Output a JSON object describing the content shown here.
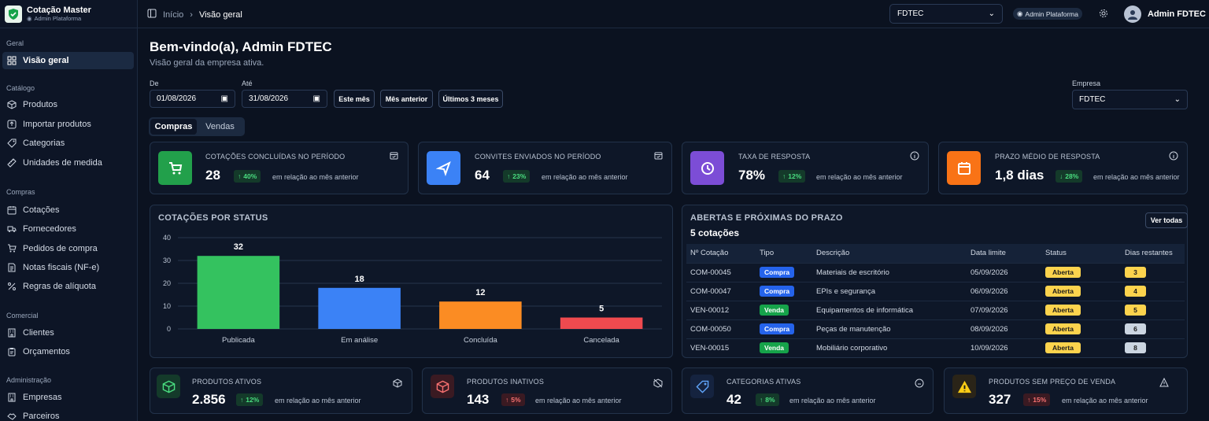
{
  "brand": {
    "title": "Cotação Master",
    "subtitle": "Admin Plataforma"
  },
  "sidebar": {
    "sections": [
      {
        "title": "Geral",
        "items": [
          {
            "label": "Visão geral",
            "icon": "dashboard-icon",
            "active": true
          }
        ]
      },
      {
        "title": "Catálogo",
        "items": [
          {
            "label": "Produtos",
            "icon": "box-icon"
          },
          {
            "label": "Importar produtos",
            "icon": "upload-icon"
          },
          {
            "label": "Categorias",
            "icon": "tag-icon"
          },
          {
            "label": "Unidades de medida",
            "icon": "ruler-icon"
          }
        ]
      },
      {
        "title": "Compras",
        "items": [
          {
            "label": "Cotações",
            "icon": "calendar-icon"
          },
          {
            "label": "Fornecedores",
            "icon": "truck-icon"
          },
          {
            "label": "Pedidos de compra",
            "icon": "cart-icon"
          },
          {
            "label": "Notas fiscais (NF-e)",
            "icon": "document-icon"
          },
          {
            "label": "Regras de alíquota",
            "icon": "percent-icon"
          }
        ]
      },
      {
        "title": "Comercial",
        "items": [
          {
            "label": "Clientes",
            "icon": "building-icon"
          },
          {
            "label": "Orçamentos",
            "icon": "clipboard-icon"
          }
        ]
      },
      {
        "title": "Administração",
        "items": [
          {
            "label": "Empresas",
            "icon": "building-icon"
          },
          {
            "label": "Parceiros",
            "icon": "handshake-icon"
          }
        ]
      }
    ]
  },
  "topbar": {
    "breadcrumb": [
      "Início",
      "Visão geral"
    ],
    "company_select": "FDTEC",
    "role_badge": "Admin Plataforma",
    "user_name": "Admin FDTEC"
  },
  "header": {
    "title": "Bem-vindo(a), Admin FDTEC",
    "subtitle": "Visão geral da empresa ativa."
  },
  "filters": {
    "from_label": "De",
    "from_value": "01/08/2026",
    "to_label": "Até",
    "to_value": "31/08/2026",
    "quick": [
      "Este mês",
      "Mês anterior",
      "Últimos 3 meses"
    ],
    "company_label": "Empresa",
    "company_value": "FDTEC"
  },
  "tabs": [
    "Compras",
    "Vendas"
  ],
  "kpis_top": [
    {
      "title": "COTAÇÕES CONCLUÍDAS NO PERÍODO",
      "value": "28",
      "delta": "40%",
      "direction": "up",
      "compare": "em relação ao mês anterior",
      "color": "#22a04b",
      "icon": "cart-icon"
    },
    {
      "title": "CONVITES ENVIADOS NO PERÍODO",
      "value": "64",
      "delta": "23%",
      "direction": "up",
      "compare": "em relação ao mês anterior",
      "color": "#3b82f6",
      "icon": "send-icon"
    },
    {
      "title": "TAXA DE RESPOSTA",
      "value": "78%",
      "delta": "12%",
      "direction": "up",
      "compare": "em relação ao mês anterior",
      "color": "#7c4dd6",
      "icon": "clock-icon"
    },
    {
      "title": "PRAZO MÉDIO DE RESPOSTA",
      "value": "1,8 dias",
      "delta": "28%",
      "direction": "down",
      "compare": "em relação ao mês anterior",
      "color": "#f97316",
      "icon": "calendar-icon"
    }
  ],
  "status_chart": {
    "title": "COTAÇÕES POR STATUS",
    "chart_data": {
      "type": "bar",
      "categories": [
        "Publicada",
        "Em análise",
        "Concluída",
        "Cancelada"
      ],
      "values": [
        32,
        18,
        12,
        5
      ],
      "colors": [
        "#34c25f",
        "#3b82f6",
        "#fb8c23",
        "#ef4a4f"
      ],
      "ylim": [
        0,
        40
      ],
      "yticks": [
        0,
        10,
        20,
        30,
        40
      ],
      "grid": true
    }
  },
  "deadline": {
    "title": "ABERTAS E PRÓXIMAS DO PRAZO",
    "count": "5 cotações",
    "button": "Ver todas",
    "columns": [
      "Nº Cotação",
      "Tipo",
      "Descrição",
      "Data limite",
      "Status",
      "Dias restantes"
    ],
    "rows": [
      {
        "num": "COM-00045",
        "tipo": "Compra",
        "desc": "Materiais de escritório",
        "data": "05/09/2026",
        "status": "Aberta",
        "dias": "3"
      },
      {
        "num": "COM-00047",
        "tipo": "Compra",
        "desc": "EPIs e segurança",
        "data": "06/09/2026",
        "status": "Aberta",
        "dias": "4"
      },
      {
        "num": "VEN-00012",
        "tipo": "Venda",
        "desc": "Equipamentos de informática",
        "data": "07/09/2026",
        "status": "Aberta",
        "dias": "5"
      },
      {
        "num": "COM-00050",
        "tipo": "Compra",
        "desc": "Peças de manutenção",
        "data": "08/09/2026",
        "status": "Aberta",
        "dias": "6"
      },
      {
        "num": "VEN-00015",
        "tipo": "Venda",
        "desc": "Mobiliário corporativo",
        "data": "10/09/2026",
        "status": "Aberta",
        "dias": "8"
      }
    ],
    "tipo_colors": {
      "Compra": "#2563eb",
      "Venda": "#16a34a"
    },
    "dias_colors": {
      "3": "#fcd34d",
      "4": "#fcd34d",
      "5": "#fcd34d",
      "6": "#cbd5e1",
      "8": "#cbd5e1"
    }
  },
  "kpis_bottom": [
    {
      "title": "PRODUTOS ATIVOS",
      "value": "2.856",
      "delta": "12%",
      "direction": "up",
      "compare": "em relação ao mês anterior",
      "icon": "box-icon"
    },
    {
      "title": "PRODUTOS INATIVOS",
      "value": "143",
      "delta": "5%",
      "direction": "up-red",
      "compare": "em relação ao mês anterior",
      "icon": "box-icon"
    },
    {
      "title": "CATEGORIAS ATIVAS",
      "value": "42",
      "delta": "8%",
      "direction": "up",
      "compare": "em relação ao mês anterior",
      "icon": "tag-icon"
    },
    {
      "title": "PRODUTOS SEM PREÇO DE VENDA",
      "value": "327",
      "delta": "15%",
      "direction": "up-red",
      "compare": "em relação ao mês anterior",
      "icon": "warning-icon"
    }
  ]
}
